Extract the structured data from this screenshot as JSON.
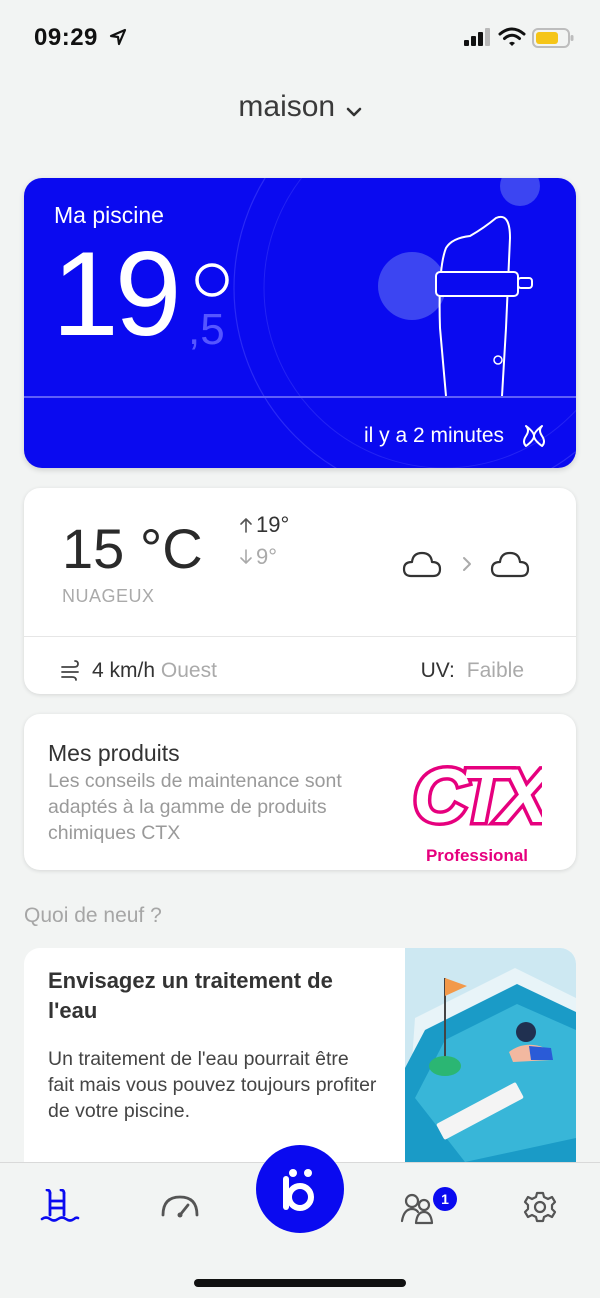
{
  "status": {
    "time": "09:29"
  },
  "location": {
    "label": "maison"
  },
  "pool": {
    "title": "Ma piscine",
    "temp_int": "19",
    "temp_dec": ",5",
    "updated": "il y a 2 minutes"
  },
  "weather": {
    "temp": "15 °C",
    "max": "19°",
    "min": "9°",
    "condition": "NUAGEUX",
    "wind_speed": "4 km/h",
    "wind_dir": "Ouest",
    "uv_label": "UV:",
    "uv_value": "Faible"
  },
  "products": {
    "title": "Mes produits",
    "description": "Les conseils de maintenance sont adaptés à la gamme de produits chimiques CTX",
    "brand": "CTX",
    "brand_sub": "Professional"
  },
  "news": {
    "heading": "Quoi de neuf ?",
    "title": "Envisagez un traitement de l'eau",
    "body": "Un traitement de l'eau pourrait être fait mais vous pouvez toujours profiter de votre piscine."
  },
  "tabbar": {
    "community_badge": "1"
  },
  "colors": {
    "accent": "#0a0af0",
    "brand": "#e6007e",
    "background": "#f2f4f3"
  }
}
